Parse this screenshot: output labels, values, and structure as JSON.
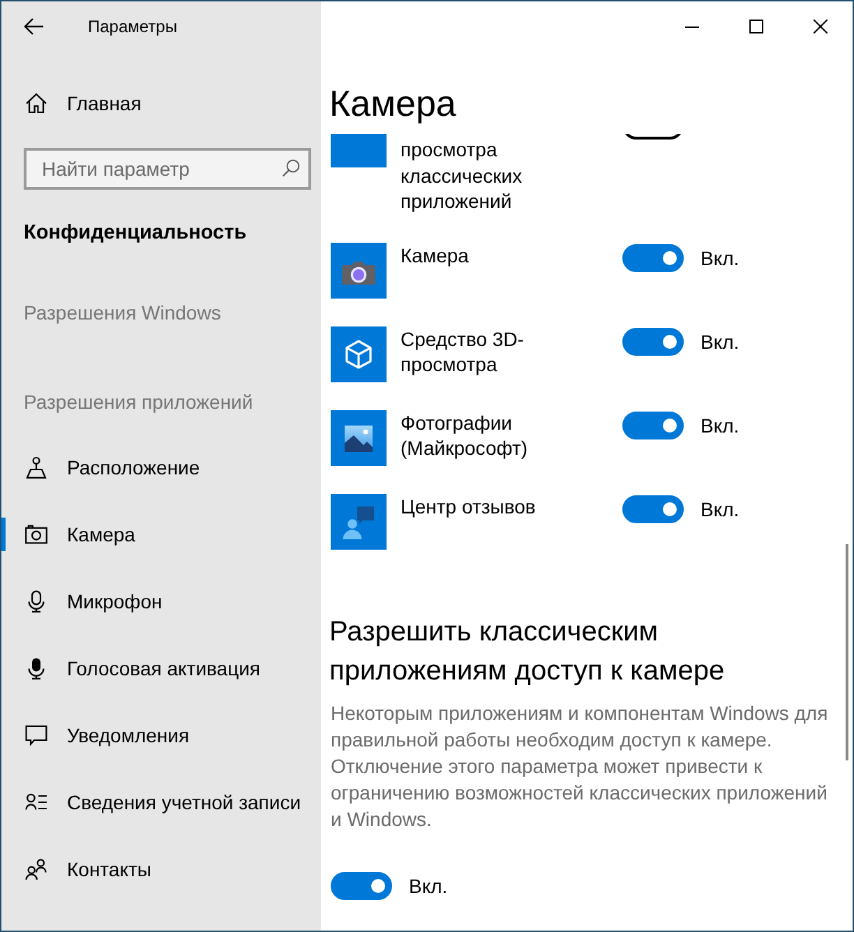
{
  "window": {
    "title": "Параметры"
  },
  "sidebar": {
    "home": "Главная",
    "search": {
      "placeholder": "Найти параметр"
    },
    "category": "Конфиденциальность",
    "groups": [
      {
        "heading": "Разрешения Windows"
      },
      {
        "heading": "Разрешения приложений",
        "items": [
          {
            "label": "Расположение",
            "selected": false
          },
          {
            "label": "Камера",
            "selected": true
          },
          {
            "label": "Микрофон",
            "selected": false
          },
          {
            "label": "Голосовая активация",
            "selected": false
          },
          {
            "label": "Уведомления",
            "selected": false
          },
          {
            "label": "Сведения учетной записи",
            "selected": false
          },
          {
            "label": "Контакты",
            "selected": false
          }
        ]
      }
    ]
  },
  "page": {
    "title": "Камера",
    "apps": [
      {
        "name": "просмотра классических приложений",
        "cut_off": true,
        "on": false
      },
      {
        "name": "Камера",
        "on": true,
        "state_label": "Вкл."
      },
      {
        "name": "Средство 3D-просмотра",
        "on": true,
        "state_label": "Вкл."
      },
      {
        "name": "Фотографии (Майкрософт)",
        "on": true,
        "state_label": "Вкл."
      },
      {
        "name": "Центр отзывов",
        "on": true,
        "state_label": "Вкл."
      }
    ],
    "desktop_apps_access": {
      "heading": "Разрешить классическим приложениям доступ к камере",
      "description": "Некоторым приложениям и компонентам Windows для правильной работы необходим доступ к камере. Отключение этого параметра может привести к ограничению возможностей классических приложений и Windows.",
      "on": true,
      "state_label": "Вкл."
    }
  }
}
